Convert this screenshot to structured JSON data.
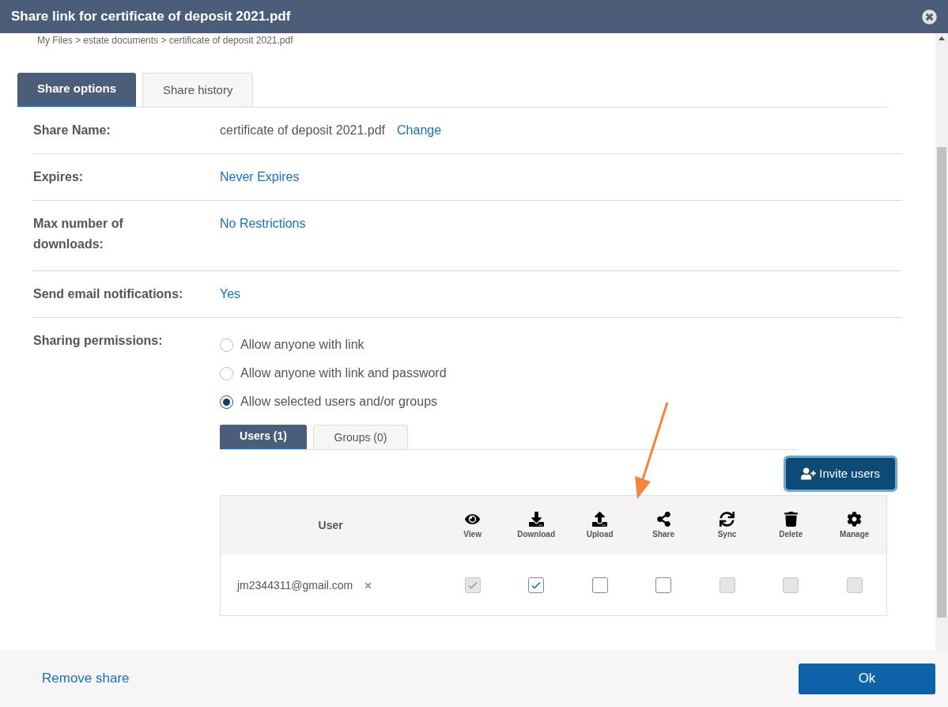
{
  "dialog": {
    "title": "Share link for certificate of deposit 2021.pdf"
  },
  "breadcrumb": "My Files > estate documents > certificate of deposit 2021.pdf",
  "tabs": [
    {
      "label": "Share options",
      "selected": true
    },
    {
      "label": "Share history",
      "selected": false
    }
  ],
  "fields": [
    {
      "label": "Share Name:",
      "value": "certificate of deposit 2021.pdf",
      "link": "Change"
    },
    {
      "label": "Expires:",
      "link": "Never Expires"
    },
    {
      "label": "Max number of\ndownloads:",
      "link": "No Restrictions"
    },
    {
      "label": "Send email notifications:",
      "link": "Yes"
    }
  ],
  "permissions": {
    "label": "Sharing permissions:",
    "options": [
      {
        "label": "Allow anyone with link",
        "selected": false
      },
      {
        "label": "Allow anyone with link and password",
        "selected": false
      },
      {
        "label": "Allow selected users and/or groups",
        "selected": true
      }
    ]
  },
  "subtabs": [
    {
      "label": "Users (1)",
      "selected": true
    },
    {
      "label": "Groups (0)",
      "selected": false
    }
  ],
  "invite_button": "Invite users",
  "table": {
    "user_column": "User",
    "columns": [
      {
        "kind": "view",
        "label": "View"
      },
      {
        "kind": "download",
        "label": "Download"
      },
      {
        "kind": "upload",
        "label": "Upload"
      },
      {
        "kind": "share",
        "label": "Share"
      },
      {
        "kind": "sync",
        "label": "Sync"
      },
      {
        "kind": "delete",
        "label": "Delete"
      },
      {
        "kind": "manage",
        "label": "Manage"
      }
    ],
    "rows": [
      {
        "user": "jm2344311@gmail.com",
        "permissions": [
          {
            "checked": true,
            "disabled": true
          },
          {
            "checked": true,
            "disabled": false
          },
          {
            "checked": false,
            "disabled": false
          },
          {
            "checked": false,
            "disabled": false
          },
          {
            "checked": false,
            "disabled": true
          },
          {
            "checked": false,
            "disabled": true
          },
          {
            "checked": false,
            "disabled": true
          }
        ]
      }
    ]
  },
  "footer": {
    "remove": "Remove share",
    "ok": "Ok"
  }
}
